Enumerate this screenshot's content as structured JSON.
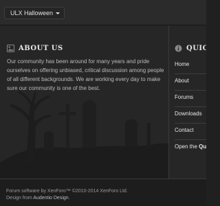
{
  "style_chooser": {
    "label": "ULX Halloween"
  },
  "about": {
    "icon": "image-icon",
    "title": "ABOUT US",
    "text": "Our community has been around for many years and pride ourselves on offering unbiased, critical discussion among people of all different backgrounds. We are working every day to make sure our community is one of the best."
  },
  "quick_nav": {
    "icon": "info-icon",
    "title": "QUICK",
    "items": [
      {
        "label": "Home"
      },
      {
        "label": "About"
      },
      {
        "label": "Forums"
      },
      {
        "label": "Downloads"
      },
      {
        "label": "Contact"
      }
    ],
    "open_prefix": "Open the ",
    "open_bold": "Qui"
  },
  "footer": {
    "line1": "Forum software by XenForo™ ©2010-2014 XenForo Ltd.",
    "line2_prefix": "Design from ",
    "line2_link": "Audentio Design",
    "line2_suffix": "."
  },
  "colors": {
    "background": "#262626",
    "text": "#bcbcbc",
    "heading": "#e8e8e8",
    "footer_bg": "#1d1d1d"
  }
}
